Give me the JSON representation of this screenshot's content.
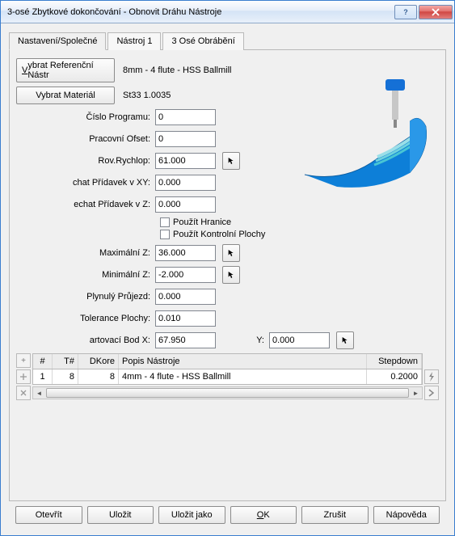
{
  "window": {
    "title": "3-osé Zbytkové dokončování - Obnovit Dráhu Nástroje"
  },
  "tabs": {
    "t0": "Nastavení/Společné",
    "t1": "Nástroj 1",
    "t2": "3 Osé Obrábění"
  },
  "top": {
    "refToolBtn": "ybrat Referenční Nástr",
    "refToolDesc": "8mm   -  4 flute - HSS Ballmill",
    "materialBtn": "Vybrat Materiál",
    "materialDesc": "St33 1.0035"
  },
  "labels": {
    "program": "Číslo Programu:",
    "workOffset": "Pracovní Ofset:",
    "rapid": "Rov.Rychlop:",
    "allowXY": "chat Přídavek v XY:",
    "allowZ": "echat Přídavek v Z:",
    "useBoundary": "Použít Hranice",
    "useCheck": "Použít Kontrolní Plochy",
    "maxZ": "Maximální Z:",
    "minZ": "Minimální Z:",
    "smooth": "Plynulý Průjezd:",
    "tol": "Tolerance Plochy:",
    "startX": "artovací Bod X:",
    "yLabel": "Y:"
  },
  "values": {
    "program": "0",
    "workOffset": "0",
    "rapid": "61.000",
    "allowXY": "0.000",
    "allowZ": "0.000",
    "maxZ": "36.000",
    "minZ": "-2.000",
    "smooth": "0.000",
    "tol": "0.010",
    "startX": "67.950",
    "startY": "0.000"
  },
  "grid": {
    "plus": "+",
    "hdr_idx": "#",
    "hdr_t": "T#",
    "hdr_dk": "DKore",
    "hdr_desc": "Popis Nástroje",
    "hdr_step": "Stepdown",
    "rows": [
      {
        "idx": "1",
        "t": "8",
        "dk": "8",
        "desc": "4mm   -  4 flute - HSS Ballmill",
        "step": "0.2000"
      }
    ]
  },
  "footer": {
    "open": "Otevřít",
    "save": "Uložit",
    "saveAs": "Uložit jako",
    "ok": "OK",
    "cancel": "Zrušit",
    "help": "Nápověda"
  }
}
